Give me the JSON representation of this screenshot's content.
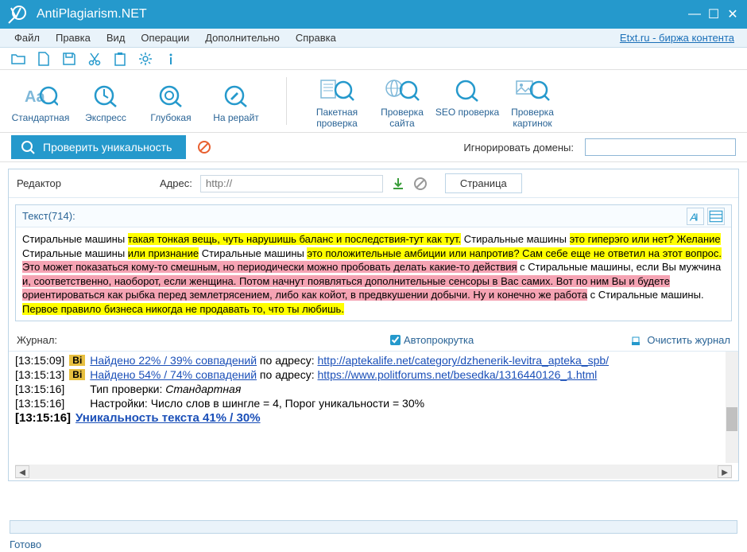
{
  "app": {
    "title": "AntiPlagiarism.NET"
  },
  "menu": {
    "file": "Файл",
    "edit": "Правка",
    "view": "Вид",
    "ops": "Операции",
    "extra": "Дополнительно",
    "help": "Справка",
    "extlink": "Etxt.ru - биржа контента"
  },
  "ribbon": {
    "standard": "Стандартная",
    "express": "Экспресс",
    "deep": "Глубокая",
    "rewrite": "На рерайт",
    "batch": "Пакетная проверка",
    "site": "Проверка сайта",
    "seo": "SEO проверка",
    "images": "Проверка картинок"
  },
  "check": {
    "button": "Проверить уникальность",
    "ignore": "Игнорировать домены:"
  },
  "editor": {
    "label": "Редактор",
    "addresslabel": "Адрес:",
    "addressplaceholder": "http://",
    "pagetab": "Страница",
    "textheader": "Текст(714):",
    "seg1": "Стиральные машины ",
    "seg2": "такая тонкая вещь, чуть нарушишь баланс и последствия-тут как тут.",
    "seg3": " Стиральные машины ",
    "seg4": "это гиперэго или нет? Желание",
    "seg5": " Стиральные машины ",
    "seg6": "или признание",
    "seg7": " Стиральные машины ",
    "seg8": "это положительные амбиции или напротив? Сам себе еще не ответил на этот вопрос.",
    "seg9": " Это может показаться кому-то смешным, но периодически можно пробовать делать какие-то действия",
    "seg10": " с Стиральные машины, если Вы мужчина ",
    "seg11": "и, соответственно, наоборот, если женщина. Потом начнут появляться дополнительные сенсоры в Вас самих. Вот по ним Вы и будете ориентироваться как рыбка перед землетрясением, либо как койот, в предвкушении добычи. Ну и конечно же работа",
    "seg12": " с Стиральные машины. ",
    "seg13": "Первое правило бизнеса никогда не продавать то, что ты любишь."
  },
  "journal": {
    "label": "Журнал:",
    "autoscroll": "Автопрокрутка",
    "clear": "Очистить журнал",
    "rows": [
      {
        "time": "[13:15:09]",
        "badge": "Bi",
        "found": "Найдено 22% / 39% совпадений",
        "mid": " по адресу: ",
        "url": "http://aptekalife.net/category/dzhenerik-levitra_apteka_spb/"
      },
      {
        "time": "[13:15:13]",
        "badge": "Bi",
        "found": "Найдено 54% / 74% совпадений",
        "mid": " по адресу: ",
        "url": "https://www.politforums.net/besedka/1316440126_1.html"
      },
      {
        "time": "[13:15:16]",
        "text1": "Тип проверки: ",
        "text2": "Стандартная"
      },
      {
        "time": "[13:15:16]",
        "text1": "Настройки: Число слов в шингле = 4, Порог уникальности = 30%"
      },
      {
        "time": "[13:15:16]",
        "result": "Уникальность текста 41% / 30%"
      }
    ]
  },
  "status": {
    "ready": "Готово"
  }
}
